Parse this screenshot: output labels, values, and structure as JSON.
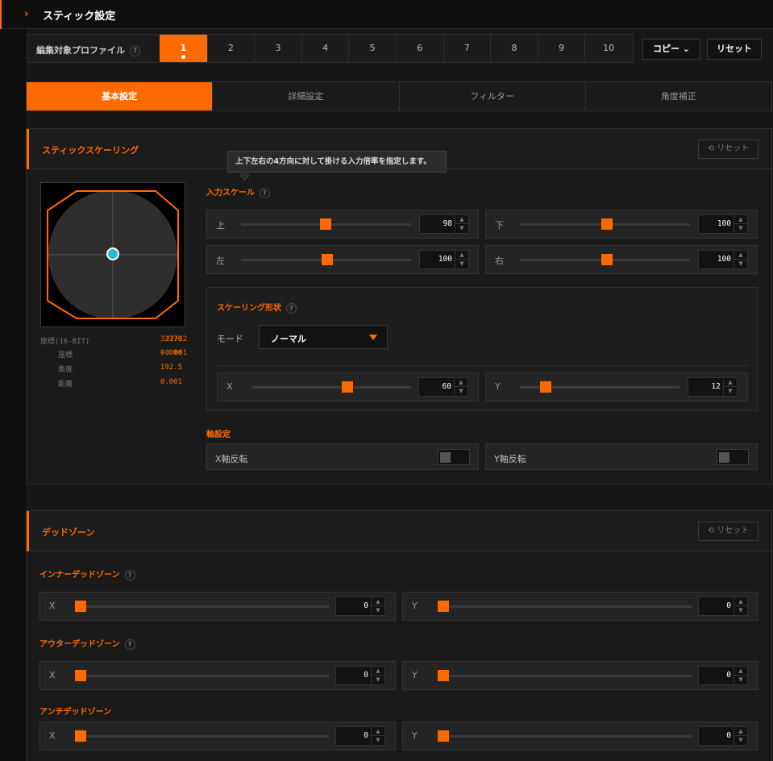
{
  "header": {
    "title": "スティック設定"
  },
  "profile": {
    "label": "編集対象プロファイル",
    "help": "?",
    "tabs": [
      "1",
      "2",
      "3",
      "4",
      "5",
      "6",
      "7",
      "8",
      "9",
      "10"
    ],
    "active_index": 0,
    "copy_label": "コピー ⌄",
    "reset_label": "リセット"
  },
  "main_tabs": [
    "基本設定",
    "詳細設定",
    "フィルター",
    "角度補正"
  ],
  "scaling": {
    "title": "スティックスケーリング",
    "reset_label": "リセット",
    "tooltip": "上下左右の4方向に対して掛ける入力倍率を指定します。",
    "coords": {
      "r1": {
        "k": "座標(16-BIT)",
        "v1": "32776",
        "v2": "32732"
      },
      "r2": {
        "k": "座標",
        "v1": "0.000",
        "v2": "-0.001"
      },
      "r3": {
        "k": "角度",
        "v1": "192.5"
      },
      "r4": {
        "k": "距離",
        "v1": "0.001"
      }
    },
    "input_scale": {
      "title": "入力スケール",
      "help": "?",
      "up": {
        "label": "上",
        "value": "98"
      },
      "down": {
        "label": "下",
        "value": "100"
      },
      "left": {
        "label": "左",
        "value": "100"
      },
      "right": {
        "label": "右",
        "value": "100"
      }
    },
    "shape": {
      "title": "スケーリング形状",
      "help": "?",
      "mode_label": "モード",
      "mode_value": "ノーマル",
      "x": {
        "label": "X",
        "value": "60"
      },
      "y": {
        "label": "Y",
        "value": "12"
      }
    },
    "axis": {
      "title": "軸設定",
      "x_invert": {
        "label": "X軸反転",
        "on": false
      },
      "y_invert": {
        "label": "Y軸反転",
        "on": false
      }
    }
  },
  "deadzone": {
    "title": "デッドゾーン",
    "reset_label": "リセット",
    "inner": {
      "title": "インナーデッドゾーン",
      "help": "?",
      "x": {
        "label": "X",
        "value": "0"
      },
      "y": {
        "label": "Y",
        "value": "0"
      }
    },
    "outer": {
      "title": "アウターデッドゾーン",
      "help": "?",
      "x": {
        "label": "X",
        "value": "0"
      },
      "y": {
        "label": "Y",
        "value": "0"
      }
    },
    "anti": {
      "title": "アンチデッドゾーン",
      "x": {
        "label": "X",
        "value": "0"
      },
      "y": {
        "label": "Y",
        "value": "0"
      }
    }
  },
  "colors": {
    "accent": "#ff6a00",
    "cursor": "#2ab8d4"
  },
  "icons": {
    "chevron": "chevron-right-icon",
    "reset": "refresh-icon",
    "help": "question-circle-icon",
    "mode_caret": "caret-down-icon"
  }
}
